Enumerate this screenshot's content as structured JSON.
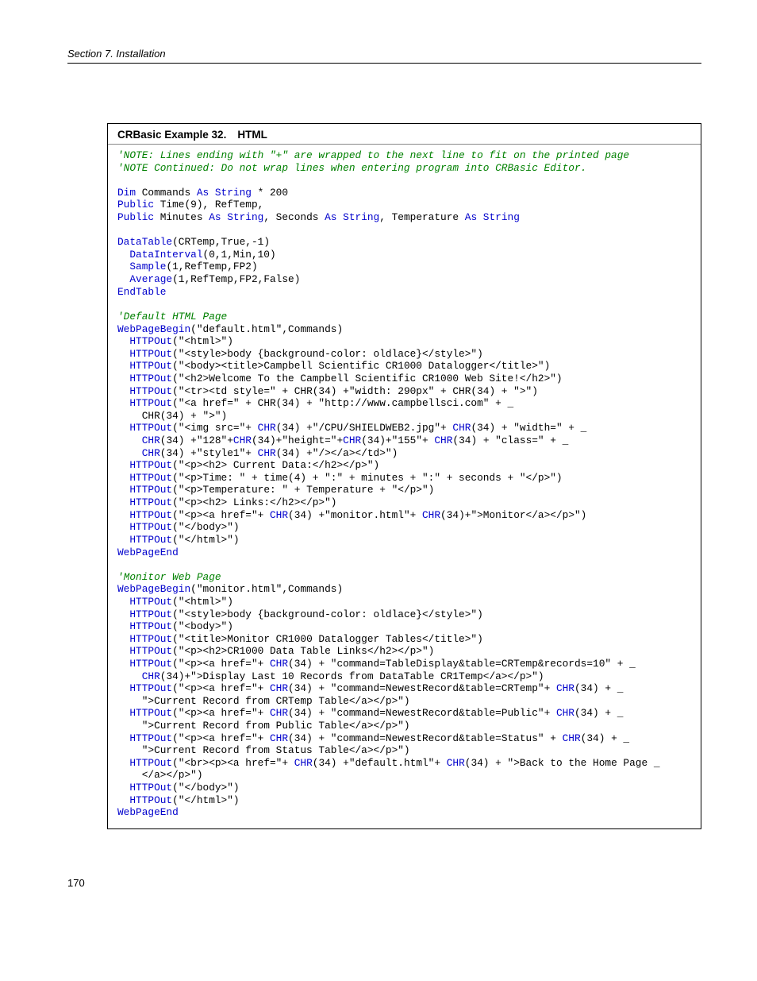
{
  "section_header": "Section 7.  Installation",
  "example_label": "CRBasic Example 32.",
  "example_name": "HTML",
  "page_number": "170",
  "code_lines": [
    {
      "cls": "com",
      "txt": "'NOTE: Lines ending with \"+\" are wrapped to the next line to fit on the printed page"
    },
    {
      "cls": "com",
      "txt": "'NOTE Continued: Do not wrap lines when entering program into CRBasic Editor."
    },
    {
      "cls": "",
      "txt": ""
    },
    {
      "segs": [
        {
          "c": "kw",
          "t": "Dim"
        },
        {
          "c": "",
          "t": " Commands "
        },
        {
          "c": "kw",
          "t": "As String"
        },
        {
          "c": "",
          "t": " * 200"
        }
      ]
    },
    {
      "segs": [
        {
          "c": "kw",
          "t": "Public"
        },
        {
          "c": "",
          "t": " Time(9), RefTemp,"
        }
      ]
    },
    {
      "segs": [
        {
          "c": "kw",
          "t": "Public"
        },
        {
          "c": "",
          "t": " Minutes "
        },
        {
          "c": "kw",
          "t": "As String"
        },
        {
          "c": "",
          "t": ", Seconds "
        },
        {
          "c": "kw",
          "t": "As String"
        },
        {
          "c": "",
          "t": ", Temperature "
        },
        {
          "c": "kw",
          "t": "As String"
        }
      ]
    },
    {
      "cls": "",
      "txt": ""
    },
    {
      "segs": [
        {
          "c": "kw",
          "t": "DataTable"
        },
        {
          "c": "",
          "t": "(CRTemp,True,-1)"
        }
      ]
    },
    {
      "segs": [
        {
          "c": "",
          "t": "  "
        },
        {
          "c": "kw",
          "t": "DataInterval"
        },
        {
          "c": "",
          "t": "(0,1,Min,10)"
        }
      ]
    },
    {
      "segs": [
        {
          "c": "",
          "t": "  "
        },
        {
          "c": "kw",
          "t": "Sample"
        },
        {
          "c": "",
          "t": "(1,RefTemp,FP2)"
        }
      ]
    },
    {
      "segs": [
        {
          "c": "",
          "t": "  "
        },
        {
          "c": "kw",
          "t": "Average"
        },
        {
          "c": "",
          "t": "(1,RefTemp,FP2,False)"
        }
      ]
    },
    {
      "segs": [
        {
          "c": "kw",
          "t": "EndTable"
        }
      ]
    },
    {
      "cls": "",
      "txt": ""
    },
    {
      "cls": "com",
      "txt": "'Default HTML Page"
    },
    {
      "segs": [
        {
          "c": "kw",
          "t": "WebPageBegin"
        },
        {
          "c": "",
          "t": "(\"default.html\",Commands)"
        }
      ]
    },
    {
      "segs": [
        {
          "c": "",
          "t": "  "
        },
        {
          "c": "kw",
          "t": "HTTPOut"
        },
        {
          "c": "",
          "t": "(\"<html>\")"
        }
      ]
    },
    {
      "segs": [
        {
          "c": "",
          "t": "  "
        },
        {
          "c": "kw",
          "t": "HTTPOut"
        },
        {
          "c": "",
          "t": "(\"<style>body {background-color: oldlace}</style>\")"
        }
      ]
    },
    {
      "segs": [
        {
          "c": "",
          "t": "  "
        },
        {
          "c": "kw",
          "t": "HTTPOut"
        },
        {
          "c": "",
          "t": "(\"<body><title>Campbell Scientific CR1000 Datalogger</title>\")"
        }
      ]
    },
    {
      "segs": [
        {
          "c": "",
          "t": "  "
        },
        {
          "c": "kw",
          "t": "HTTPOut"
        },
        {
          "c": "",
          "t": "(\"<h2>Welcome To the Campbell Scientific CR1000 Web Site!</h2>\")"
        }
      ]
    },
    {
      "segs": [
        {
          "c": "",
          "t": "  "
        },
        {
          "c": "kw",
          "t": "HTTPOut"
        },
        {
          "c": "",
          "t": "(\"<tr><td style=\" + CHR(34) +\"width: 290px\" + CHR(34) + \">\")"
        }
      ]
    },
    {
      "segs": [
        {
          "c": "",
          "t": "  "
        },
        {
          "c": "kw",
          "t": "HTTPOut"
        },
        {
          "c": "",
          "t": "(\"<a href=\" + CHR(34) + \"http://www.campbellsci.com\" + _"
        }
      ]
    },
    {
      "segs": [
        {
          "c": "",
          "t": "    CHR(34) + \">\")"
        }
      ]
    },
    {
      "segs": [
        {
          "c": "",
          "t": "  "
        },
        {
          "c": "kw",
          "t": "HTTPOut"
        },
        {
          "c": "",
          "t": "(\"<img src=\"+ "
        },
        {
          "c": "kw",
          "t": "CHR"
        },
        {
          "c": "",
          "t": "(34) +\"/CPU/SHIELDWEB2.jpg\"+ "
        },
        {
          "c": "kw",
          "t": "CHR"
        },
        {
          "c": "",
          "t": "(34) + \"width=\" + _"
        }
      ]
    },
    {
      "segs": [
        {
          "c": "",
          "t": "    "
        },
        {
          "c": "kw",
          "t": "CHR"
        },
        {
          "c": "",
          "t": "(34) +\"128\"+"
        },
        {
          "c": "kw",
          "t": "CHR"
        },
        {
          "c": "",
          "t": "(34)+\"height=\"+"
        },
        {
          "c": "kw",
          "t": "CHR"
        },
        {
          "c": "",
          "t": "(34)+\"155\"+ "
        },
        {
          "c": "kw",
          "t": "CHR"
        },
        {
          "c": "",
          "t": "(34) + \"class=\" + _"
        }
      ]
    },
    {
      "segs": [
        {
          "c": "",
          "t": "    "
        },
        {
          "c": "kw",
          "t": "CHR"
        },
        {
          "c": "",
          "t": "(34) +\"style1\"+ "
        },
        {
          "c": "kw",
          "t": "CHR"
        },
        {
          "c": "",
          "t": "(34) +\"/></a></td>\")"
        }
      ]
    },
    {
      "segs": [
        {
          "c": "",
          "t": "  "
        },
        {
          "c": "kw",
          "t": "HTTPOut"
        },
        {
          "c": "",
          "t": "(\"<p><h2> Current Data:</h2></p>\")"
        }
      ]
    },
    {
      "segs": [
        {
          "c": "",
          "t": "  "
        },
        {
          "c": "kw",
          "t": "HTTPOut"
        },
        {
          "c": "",
          "t": "(\"<p>Time: \" + time(4) + \":\" + minutes + \":\" + seconds + \"</p>\")"
        }
      ]
    },
    {
      "segs": [
        {
          "c": "",
          "t": "  "
        },
        {
          "c": "kw",
          "t": "HTTPOut"
        },
        {
          "c": "",
          "t": "(\"<p>Temperature: \" + Temperature + \"</p>\")"
        }
      ]
    },
    {
      "segs": [
        {
          "c": "",
          "t": "  "
        },
        {
          "c": "kw",
          "t": "HTTPOut"
        },
        {
          "c": "",
          "t": "(\"<p><h2> Links:</h2></p>\")"
        }
      ]
    },
    {
      "segs": [
        {
          "c": "",
          "t": "  "
        },
        {
          "c": "kw",
          "t": "HTTPOut"
        },
        {
          "c": "",
          "t": "(\"<p><a href=\"+ "
        },
        {
          "c": "kw",
          "t": "CHR"
        },
        {
          "c": "",
          "t": "(34) +\"monitor.html\"+ "
        },
        {
          "c": "kw",
          "t": "CHR"
        },
        {
          "c": "",
          "t": "(34)+\">Monitor</a></p>\")"
        }
      ]
    },
    {
      "segs": [
        {
          "c": "",
          "t": "  "
        },
        {
          "c": "kw",
          "t": "HTTPOut"
        },
        {
          "c": "",
          "t": "(\"</body>\")"
        }
      ]
    },
    {
      "segs": [
        {
          "c": "",
          "t": "  "
        },
        {
          "c": "kw",
          "t": "HTTPOut"
        },
        {
          "c": "",
          "t": "(\"</html>\")"
        }
      ]
    },
    {
      "segs": [
        {
          "c": "kw",
          "t": "WebPageEnd"
        }
      ]
    },
    {
      "cls": "",
      "txt": ""
    },
    {
      "cls": "com",
      "txt": "'Monitor Web Page"
    },
    {
      "segs": [
        {
          "c": "kw",
          "t": "WebPageBegin"
        },
        {
          "c": "",
          "t": "(\"monitor.html\",Commands)"
        }
      ]
    },
    {
      "segs": [
        {
          "c": "",
          "t": "  "
        },
        {
          "c": "kw",
          "t": "HTTPOut"
        },
        {
          "c": "",
          "t": "(\"<html>\")"
        }
      ]
    },
    {
      "segs": [
        {
          "c": "",
          "t": "  "
        },
        {
          "c": "kw",
          "t": "HTTPOut"
        },
        {
          "c": "",
          "t": "(\"<style>body {background-color: oldlace}</style>\")"
        }
      ]
    },
    {
      "segs": [
        {
          "c": "",
          "t": "  "
        },
        {
          "c": "kw",
          "t": "HTTPOut"
        },
        {
          "c": "",
          "t": "(\"<body>\")"
        }
      ]
    },
    {
      "segs": [
        {
          "c": "",
          "t": "  "
        },
        {
          "c": "kw",
          "t": "HTTPOut"
        },
        {
          "c": "",
          "t": "(\"<title>Monitor CR1000 Datalogger Tables</title>\")"
        }
      ]
    },
    {
      "segs": [
        {
          "c": "",
          "t": "  "
        },
        {
          "c": "kw",
          "t": "HTTPOut"
        },
        {
          "c": "",
          "t": "(\"<p><h2>CR1000 Data Table Links</h2></p>\")"
        }
      ]
    },
    {
      "segs": [
        {
          "c": "",
          "t": "  "
        },
        {
          "c": "kw",
          "t": "HTTPOut"
        },
        {
          "c": "",
          "t": "(\"<p><a href=\"+ "
        },
        {
          "c": "kw",
          "t": "CHR"
        },
        {
          "c": "",
          "t": "(34) + \"command=TableDisplay&table=CRTemp&records=10\" + _"
        }
      ]
    },
    {
      "segs": [
        {
          "c": "",
          "t": "    "
        },
        {
          "c": "kw",
          "t": "CHR"
        },
        {
          "c": "",
          "t": "(34)+\">Display Last 10 Records from DataTable CR1Temp</a></p>\")"
        }
      ]
    },
    {
      "segs": [
        {
          "c": "",
          "t": "  "
        },
        {
          "c": "kw",
          "t": "HTTPOut"
        },
        {
          "c": "",
          "t": "(\"<p><a href=\"+ "
        },
        {
          "c": "kw",
          "t": "CHR"
        },
        {
          "c": "",
          "t": "(34) + \"command=NewestRecord&table=CRTemp\"+ "
        },
        {
          "c": "kw",
          "t": "CHR"
        },
        {
          "c": "",
          "t": "(34) + _"
        }
      ]
    },
    {
      "segs": [
        {
          "c": "",
          "t": "    \">Current Record from CRTemp Table</a></p>\")"
        }
      ]
    },
    {
      "segs": [
        {
          "c": "",
          "t": "  "
        },
        {
          "c": "kw",
          "t": "HTTPOut"
        },
        {
          "c": "",
          "t": "(\"<p><a href=\"+ "
        },
        {
          "c": "kw",
          "t": "CHR"
        },
        {
          "c": "",
          "t": "(34) + \"command=NewestRecord&table=Public\"+ "
        },
        {
          "c": "kw",
          "t": "CHR"
        },
        {
          "c": "",
          "t": "(34) + _"
        }
      ]
    },
    {
      "segs": [
        {
          "c": "",
          "t": "    \">Current Record from Public Table</a></p>\")"
        }
      ]
    },
    {
      "segs": [
        {
          "c": "",
          "t": "  "
        },
        {
          "c": "kw",
          "t": "HTTPOut"
        },
        {
          "c": "",
          "t": "(\"<p><a href=\"+ "
        },
        {
          "c": "kw",
          "t": "CHR"
        },
        {
          "c": "",
          "t": "(34) + \"command=NewestRecord&table=Status\" + "
        },
        {
          "c": "kw",
          "t": "CHR"
        },
        {
          "c": "",
          "t": "(34) + _"
        }
      ]
    },
    {
      "segs": [
        {
          "c": "",
          "t": "    \">Current Record from Status Table</a></p>\")"
        }
      ]
    },
    {
      "segs": [
        {
          "c": "",
          "t": "  "
        },
        {
          "c": "kw",
          "t": "HTTPOut"
        },
        {
          "c": "",
          "t": "(\"<br><p><a href=\"+ "
        },
        {
          "c": "kw",
          "t": "CHR"
        },
        {
          "c": "",
          "t": "(34) +\"default.html\"+ "
        },
        {
          "c": "kw",
          "t": "CHR"
        },
        {
          "c": "",
          "t": "(34) + \">Back to the Home Page _"
        }
      ]
    },
    {
      "segs": [
        {
          "c": "",
          "t": "    </a></p>\")"
        }
      ]
    },
    {
      "segs": [
        {
          "c": "",
          "t": "  "
        },
        {
          "c": "kw",
          "t": "HTTPOut"
        },
        {
          "c": "",
          "t": "(\"</body>\")"
        }
      ]
    },
    {
      "segs": [
        {
          "c": "",
          "t": "  "
        },
        {
          "c": "kw",
          "t": "HTTPOut"
        },
        {
          "c": "",
          "t": "(\"</html>\")"
        }
      ]
    },
    {
      "segs": [
        {
          "c": "kw",
          "t": "WebPageEnd"
        }
      ]
    }
  ]
}
